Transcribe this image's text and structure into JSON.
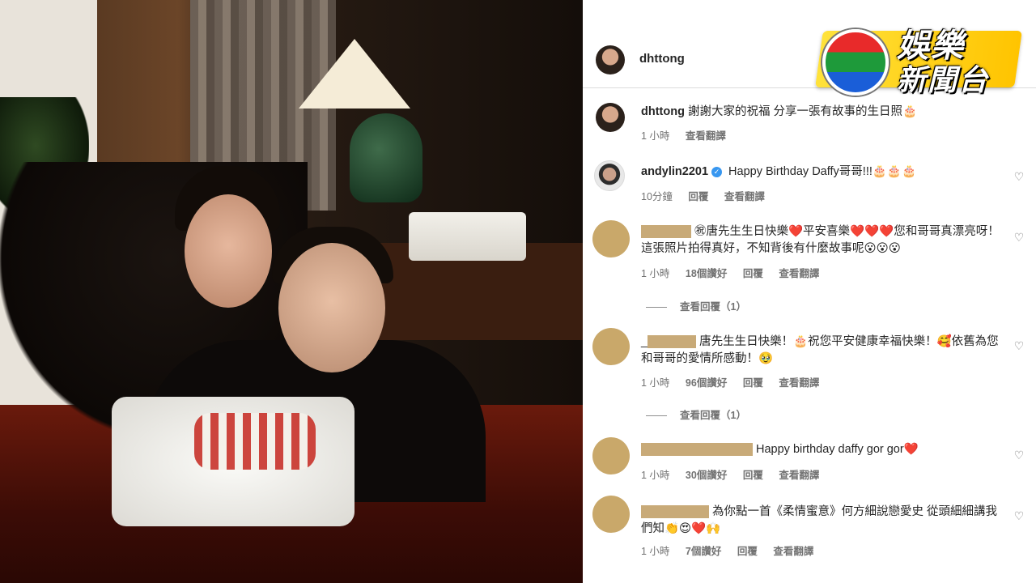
{
  "logo": {
    "line1": "娛樂",
    "line2": "新聞台"
  },
  "header": {
    "username": "dhttong"
  },
  "comments": [
    {
      "user": "dhttong",
      "text": "謝謝大家的祝福 分享一張有故事的生日照🎂",
      "time": "1 小時",
      "translate": "查看翻譯"
    },
    {
      "user": "andylin2201",
      "verified": true,
      "text": "Happy Birthday Daffy哥哥!!!🎂🎂🎂",
      "time": "10分鐘",
      "reply": "回覆",
      "translate": "查看翻譯"
    },
    {
      "text": "㊗唐先生生日快樂❤️平安喜樂❤️❤️❤️您和哥哥真漂亮呀！這張照片拍得真好，不知背後有什麼故事呢😮😮😮",
      "time": "1 小時",
      "likes": "18個讚好",
      "reply": "回覆",
      "translate": "查看翻譯",
      "view_replies": "查看回覆（1）"
    },
    {
      "prefix": "_",
      "text": "唐先生生日快樂！🎂祝您平安健康幸福快樂！🥰依舊為您和哥哥的愛情所感動！🥹",
      "time": "1 小時",
      "likes": "96個讚好",
      "reply": "回覆",
      "translate": "查看翻譯",
      "view_replies": "查看回覆（1）"
    },
    {
      "text": "Happy birthday daffy gor gor❤️",
      "time": "1 小時",
      "likes": "30個讚好",
      "reply": "回覆",
      "translate": "查看翻譯"
    },
    {
      "text": "為你點一首《柔情蜜意》何方細說戀愛史 從頭細細講我們知👏😍❤️🙌",
      "time": "1 小時",
      "likes": "7個讚好",
      "reply": "回覆",
      "translate": "查看翻譯"
    }
  ],
  "icons": {
    "like": "heart-icon",
    "verified": "verified-badge-icon"
  },
  "colors": {
    "redaction": "#c8aa78",
    "verified": "#3897f0",
    "logo_yellow": "#ffd200"
  }
}
